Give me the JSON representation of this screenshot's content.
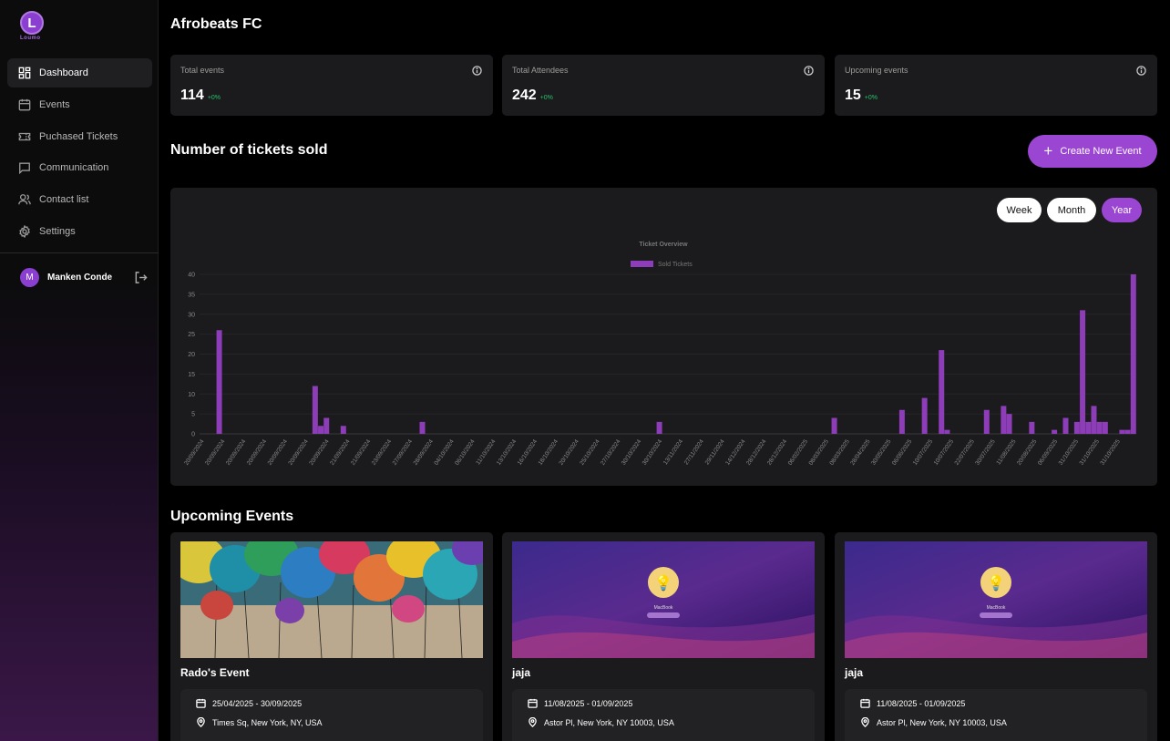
{
  "app": {
    "logo_letter": "L",
    "logo_text": "Loumo"
  },
  "sidebar": {
    "items": [
      {
        "label": "Dashboard",
        "icon": "dashboard-icon",
        "active": true
      },
      {
        "label": "Events",
        "icon": "calendar-icon"
      },
      {
        "label": "Puchased Tickets",
        "icon": "ticket-icon"
      },
      {
        "label": "Communication",
        "icon": "chat-icon"
      },
      {
        "label": "Contact list",
        "icon": "users-icon"
      },
      {
        "label": "Settings",
        "icon": "gear-icon"
      }
    ],
    "user": {
      "initial": "M",
      "name": "Manken Conde"
    }
  },
  "header": {
    "title": "Afrobeats FC"
  },
  "stats": [
    {
      "label": "Total events",
      "value": "114",
      "delta": "+0%"
    },
    {
      "label": "Total Attendees",
      "value": "242",
      "delta": "+0%"
    },
    {
      "label": "Upcoming events",
      "value": "15",
      "delta": "+0%"
    }
  ],
  "tickets_section": {
    "title": "Number of tickets sold",
    "create_label": "Create New Event",
    "create_icon": "plus-icon"
  },
  "range": {
    "options": [
      "Week",
      "Month",
      "Year"
    ],
    "selected": "Year"
  },
  "colors": {
    "accent": "#9b45d3",
    "bar": "#8e3db8",
    "positive": "#27c26c"
  },
  "chart_data": {
    "type": "bar",
    "title": "Ticket Overview",
    "legend": "Sold Tickets",
    "legend_position": "top-center",
    "ylim": [
      0,
      40
    ],
    "yticks": [
      0,
      5,
      10,
      15,
      20,
      25,
      30,
      35,
      40
    ],
    "grid": true,
    "xtick_labels": [
      "20/09/2024",
      "20/09/2024",
      "20/09/2024",
      "20/09/2024",
      "20/09/2024",
      "20/09/2024",
      "20/09/2024",
      "21/09/2024",
      "21/09/2024",
      "23/09/2024",
      "27/09/2024",
      "28/09/2024",
      "04/10/2024",
      "06/10/2024",
      "11/10/2024",
      "13/10/2024",
      "16/10/2024",
      "18/10/2024",
      "20/10/2024",
      "25/10/2024",
      "27/10/2024",
      "30/10/2024",
      "30/10/2024",
      "13/11/2024",
      "27/11/2024",
      "29/11/2024",
      "14/12/2024",
      "28/12/2024",
      "28/12/2024",
      "06/02/2025",
      "08/03/2025",
      "08/03/2025",
      "28/04/2025",
      "30/05/2025",
      "06/06/2025",
      "10/07/2025",
      "10/07/2025",
      "22/07/2025",
      "30/07/2025",
      "11/08/2025",
      "20/08/2025",
      "06/09/2025",
      "31/10/2025",
      "31/10/2025",
      "31/10/2025"
    ],
    "values": [
      0,
      0,
      0,
      26,
      0,
      0,
      0,
      0,
      0,
      0,
      0,
      0,
      0,
      0,
      0,
      0,
      0,
      0,
      0,
      0,
      12,
      2,
      4,
      0,
      0,
      2,
      0,
      0,
      0,
      0,
      0,
      0,
      0,
      0,
      0,
      0,
      0,
      0,
      0,
      3,
      0,
      0,
      0,
      0,
      0,
      0,
      0,
      0,
      0,
      0,
      0,
      0,
      0,
      0,
      0,
      0,
      0,
      0,
      0,
      0,
      0,
      0,
      0,
      0,
      0,
      0,
      0,
      0,
      0,
      0,
      0,
      0,
      0,
      0,
      0,
      0,
      0,
      0,
      0,
      0,
      0,
      3,
      0,
      0,
      0,
      0,
      0,
      0,
      0,
      0,
      0,
      0,
      0,
      0,
      0,
      0,
      0,
      0,
      0,
      0,
      0,
      0,
      0,
      0,
      0,
      0,
      0,
      0,
      0,
      0,
      0,
      0,
      4,
      0,
      0,
      0,
      0,
      0,
      0,
      0,
      0,
      0,
      0,
      0,
      6,
      0,
      0,
      0,
      9,
      0,
      0,
      21,
      1,
      0,
      0,
      0,
      0,
      0,
      0,
      6,
      0,
      0,
      7,
      5,
      0,
      0,
      0,
      3,
      0,
      0,
      0,
      1,
      0,
      4,
      0,
      3,
      31,
      3,
      7,
      3,
      3,
      0,
      0,
      1,
      1,
      40
    ]
  },
  "upcoming": {
    "title": "Upcoming Events",
    "events": [
      {
        "name": "Rado's Event",
        "dates": "25/04/2025 - 30/09/2025",
        "location": "Times Sq, New York, NY, USA",
        "image": "balloons"
      },
      {
        "name": "jaja",
        "dates": "11/08/2025 - 01/09/2025",
        "location": "Astor Pl, New York, NY 10003, USA",
        "image": "purple-wave",
        "img_caption": "MacBook"
      },
      {
        "name": "jaja",
        "dates": "11/08/2025 - 01/09/2025",
        "location": "Astor Pl, New York, NY 10003, USA",
        "image": "purple-wave",
        "img_caption": "MacBook"
      }
    ]
  }
}
